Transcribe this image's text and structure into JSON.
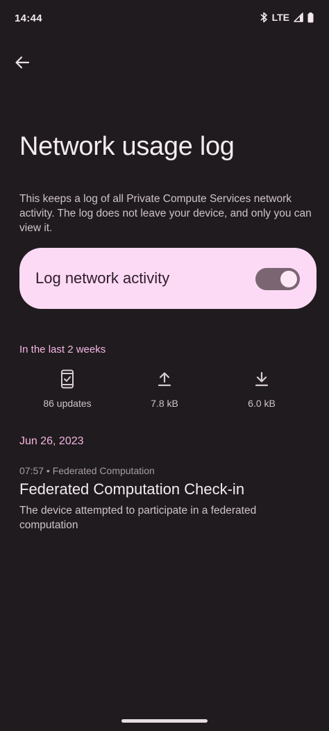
{
  "status_bar": {
    "time": "14:44",
    "network": "LTE",
    "icons": [
      "bluetooth-icon",
      "signal-icon",
      "battery-icon"
    ]
  },
  "header": {
    "back_icon": "arrow-back-icon",
    "title": "Network usage log"
  },
  "description": "This keeps a log of all Private Compute Services network activity. The log does not leave your device, and only you can view it.",
  "toggle": {
    "label": "Log network activity",
    "checked": true
  },
  "summary": {
    "header": "In the last 2 weeks",
    "stats": [
      {
        "icon": "phone-check-icon",
        "value": "86 updates"
      },
      {
        "icon": "upload-icon",
        "value": "7.8 kB"
      },
      {
        "icon": "download-icon",
        "value": "6.0 kB"
      }
    ]
  },
  "log": {
    "date": "Jun 26, 2023",
    "entries": [
      {
        "meta": "07:57 • Federated Computation",
        "title": "Federated Computation Check-in",
        "description": "The device attempted to participate in a federated computation"
      }
    ]
  },
  "colors": {
    "background": "#1f1b1e",
    "card": "#fcd9f4",
    "accent": "#f5b6e4",
    "toggle_track": "#7b6573"
  }
}
